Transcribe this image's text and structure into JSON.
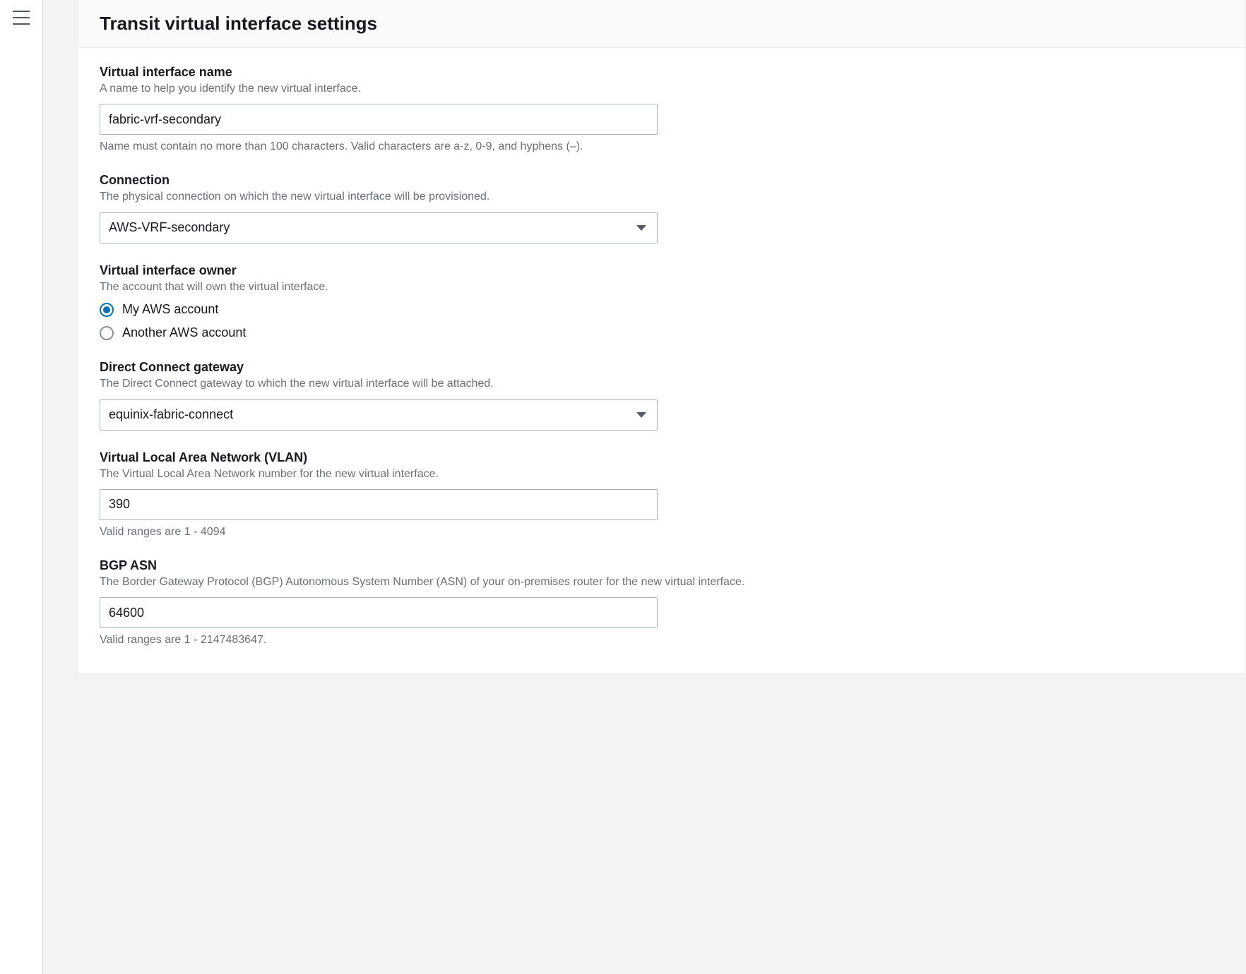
{
  "panel": {
    "title": "Transit virtual interface settings"
  },
  "fields": {
    "vif_name": {
      "label": "Virtual interface name",
      "help": "A name to help you identify the new virtual interface.",
      "value": "fabric-vrf-secondary",
      "constraint": "Name must contain no more than 100 characters. Valid characters are a-z, 0-9, and hyphens (–)."
    },
    "connection": {
      "label": "Connection",
      "help": "The physical connection on which the new virtual interface will be provisioned.",
      "value": "AWS-VRF-secondary"
    },
    "owner": {
      "label": "Virtual interface owner",
      "help": "The account that will own the virtual interface.",
      "options": [
        {
          "label": "My AWS account",
          "selected": true
        },
        {
          "label": "Another AWS account",
          "selected": false
        }
      ]
    },
    "gateway": {
      "label": "Direct Connect gateway",
      "help": "The Direct Connect gateway to which the new virtual interface will be attached.",
      "value": "equinix-fabric-connect"
    },
    "vlan": {
      "label": "Virtual Local Area Network (VLAN)",
      "help": "The Virtual Local Area Network number for the new virtual interface.",
      "value": "390",
      "constraint": "Valid ranges are 1 - 4094"
    },
    "bgp_asn": {
      "label": "BGP ASN",
      "help": "The Border Gateway Protocol (BGP) Autonomous System Number (ASN) of your on-premises router for the new virtual interface.",
      "value": "64600",
      "constraint": "Valid ranges are 1 - 2147483647."
    }
  }
}
